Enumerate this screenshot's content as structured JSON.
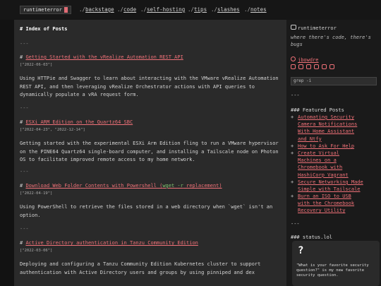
{
  "header": {
    "logo_text": "runtimeterror",
    "nav": [
      {
        "prefix": "./",
        "label": "backstage"
      },
      {
        "prefix": "./",
        "label": "code"
      },
      {
        "prefix": "./",
        "label": "self-hosting"
      },
      {
        "prefix": "./",
        "label": "tips"
      },
      {
        "prefix": "./",
        "label": "slashes"
      },
      {
        "prefix": "./",
        "label": "notes"
      }
    ]
  },
  "main": {
    "heading": "# Index of Posts",
    "separator": "---",
    "posts": [
      {
        "hash": "#",
        "title": "Getting Started with the vRealize Automation REST API",
        "date": "[\"2022-06-03\"]",
        "summary": "Using HTTPie and Swagger to learn about interacting with the VMware vRealize Automation REST API, and then leveraging vRealize Orchestrator actions with API queries to dynamically populate a vRA request form."
      },
      {
        "hash": "#",
        "title": "ESXi ARM Edition on the Quartz64 SBC",
        "date": "[\"2022-04-23\", \"2022-12-14\"]",
        "summary": "Getting started with the experimental ESXi Arm Edition fling to run a VMware hypervisor on the PINE64 Quartz64 single-board computer, and installing a Tailscale node on Photon OS to facilitate improved remote access to my home network."
      },
      {
        "hash": "#",
        "title_before": "Download Web Folder Contents with Powershell (",
        "title_code": "wget -r",
        "title_after": " replacement)",
        "date": "[\"2022-04-19\"]",
        "summary": "Using PowerShell to retrieve the files stored in a web directory when `wget` isn't an option."
      },
      {
        "hash": "#",
        "title": "Active Directory authentication in Tanzu Community Edition",
        "date": "[\"2022-03-06\"]",
        "summary": "Deploying and configuring a Tanzu Community Edition Kubernetes cluster to support authentication with Active Directory users and groups by using pinniped and dex"
      }
    ]
  },
  "sidebar": {
    "site_name": "runtimeterror",
    "tagline": "where there's code, there's bugs",
    "author": "jbowdre",
    "search_placeholder": "grep -i",
    "separator": "---",
    "featured_heading": "### Featured Posts",
    "featured": [
      [
        "Automating Security",
        "Camera Notifications",
        "With Home Assistant",
        "and Ntfy"
      ],
      [
        "How to Ask For Help"
      ],
      [
        "Create Virtual",
        "Machines on a",
        "Chromebook with",
        "HashiCorp Vagrant"
      ],
      [
        "Secure Networking Made",
        "Simple with Tailscale"
      ],
      [
        "Burn an ISO to USB",
        "with the Chromebook",
        "Recovery Utility"
      ]
    ],
    "status_heading": "### status.lol",
    "status_emoji": "?",
    "status_text": "\"What is your favorite security question?\" is my new favorite security question."
  },
  "colors": {
    "accent": "#f07178",
    "background": "#121212",
    "panel": "#2a2a2a",
    "code": "#7ec16e"
  }
}
